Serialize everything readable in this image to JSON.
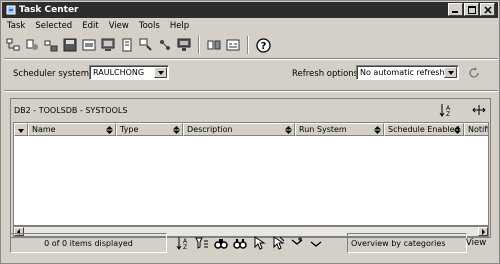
{
  "window": {
    "title": "Task Center"
  },
  "menu": [
    "Task",
    "Selected",
    "Edit",
    "View",
    "Tools",
    "Help"
  ],
  "toolbar_icons": [
    "new-task-icon",
    "new-task-wizard-icon",
    "open-task-icon",
    "save-task-icon",
    "command-editor-icon",
    "control-center-icon",
    "journal-icon",
    "task-center-icon",
    "health-center-icon",
    "replication-center-icon",
    "configuration-assistant-icon",
    "development-center-icon",
    "help-icon"
  ],
  "scheduler": {
    "label": "Scheduler system",
    "value": "RAULCHONG"
  },
  "refresh": {
    "label": "Refresh options",
    "value": "No automatic refresh"
  },
  "panel": {
    "title": "DB2 - TOOLSDB - SYSTOOLS"
  },
  "table": {
    "columns": [
      "Name",
      "Type",
      "Description",
      "Run System",
      "Schedule Enabled",
      "Notific"
    ]
  },
  "status": {
    "text": "0 of 0 items displayed"
  },
  "view": {
    "combo": "Overview by categories",
    "button": "View"
  }
}
